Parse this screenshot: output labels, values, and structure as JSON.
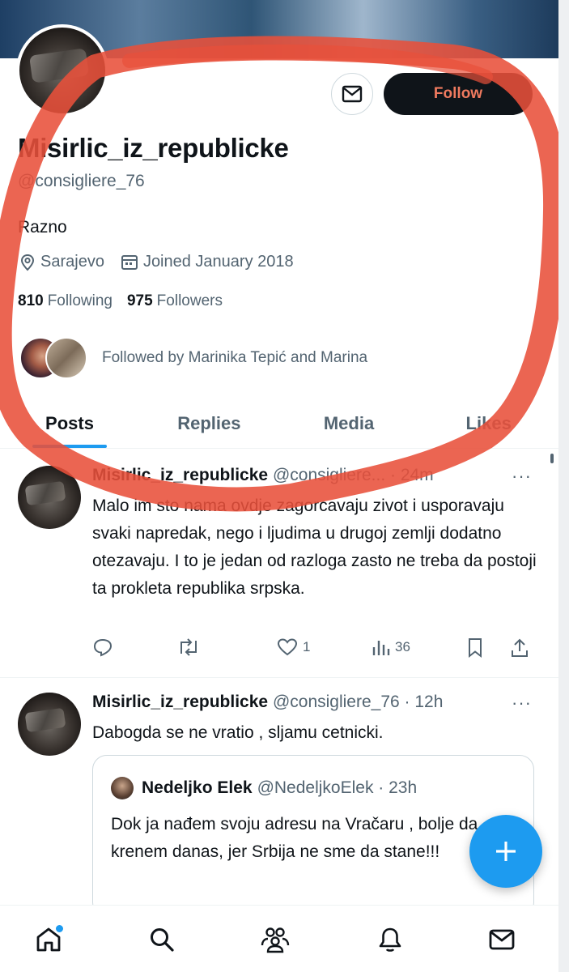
{
  "profile": {
    "display_name": "Misirlic_iz_republicke",
    "handle": "@consigliere_76",
    "bio": "Razno",
    "location": "Sarajevo",
    "joined": "Joined January 2018",
    "following_count": "810",
    "following_label": "Following",
    "followers_count": "975",
    "followers_label": "Followers",
    "followed_by": "Followed by Marinika Tepić and Marina",
    "follow_label": "Follow"
  },
  "tabs": [
    {
      "label": "Posts",
      "active": true
    },
    {
      "label": "Replies",
      "active": false
    },
    {
      "label": "Media",
      "active": false
    },
    {
      "label": "Likes",
      "active": false
    }
  ],
  "posts": [
    {
      "name": "Misirlic_iz_republicke",
      "handle_time": "@consigliere... · 24m",
      "text": "Malo im sto nama ovdje zagorcavaju zivot i usporavaju svaki napredak, nego i ljudima u drugoj zemlji dodatno otezavaju. I to je jedan od razloga zasto ne treba da postoji ta prokleta republika srpska.",
      "likes": "1",
      "views": "36"
    },
    {
      "name": "Misirlic_iz_republicke",
      "handle_time": "@consigliere_76 · 12h",
      "text": "Dabogda se ne vratio , sljamu cetnicki.",
      "quote": {
        "name": "Nedeljko Elek",
        "handle_time": "@NedeljkoElek · 23h",
        "text": "Dok ja nađem svoju adresu na Vračaru , bolje da krenem danas, jer Srbija ne sme da stane!!!"
      }
    }
  ],
  "colors": {
    "accent": "#1d9bf0",
    "annotation": "#e8503a"
  },
  "icons": {
    "more": "···",
    "compose": "plus-icon"
  }
}
